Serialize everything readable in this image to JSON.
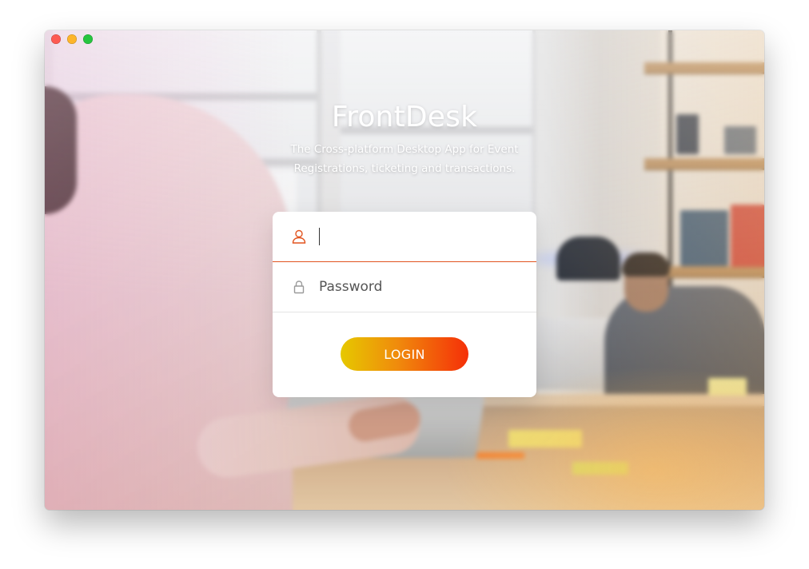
{
  "window": {
    "controls": {
      "close_color": "#fd5a52",
      "minimize_color": "#fdb52b",
      "zoom_color": "#27c53f"
    }
  },
  "hero": {
    "title": "FrontDesk",
    "subtitle": "The Cross-platform Desktop App for Event Registrations, ticketing and transactions."
  },
  "login": {
    "username": {
      "value": "",
      "placeholder": "",
      "icon": "user-icon"
    },
    "password": {
      "value": "",
      "placeholder": "Password",
      "icon": "lock-icon"
    },
    "button_label": "LOGIN"
  },
  "theme": {
    "accent": "#e2541f",
    "button_gradient": [
      "#e6c800",
      "#f08a0c",
      "#f52f08"
    ]
  }
}
